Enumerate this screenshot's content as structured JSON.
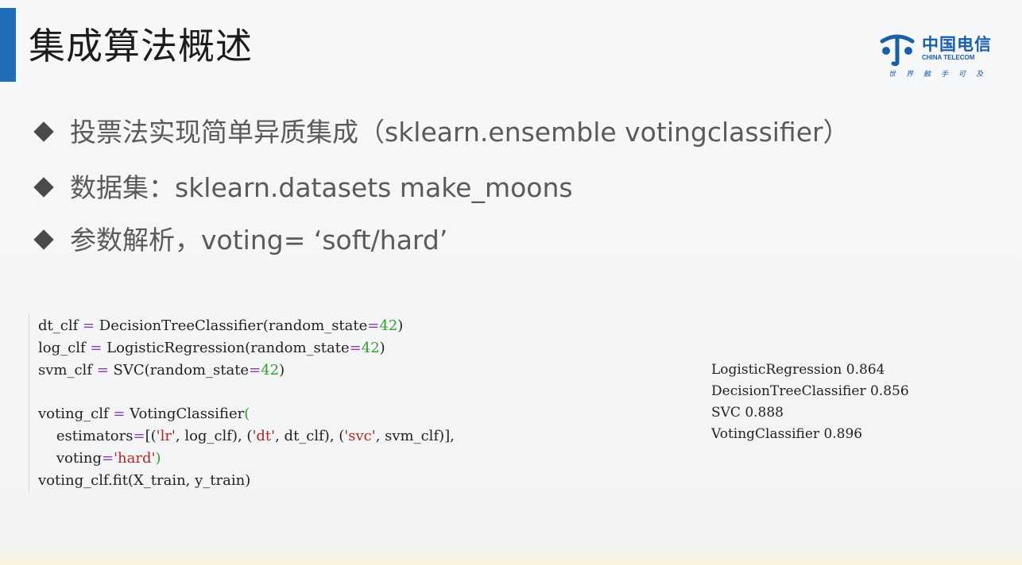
{
  "slide": {
    "title": "集成算法概述"
  },
  "logo": {
    "name_cn": "中国电信",
    "name_en": "CHINA TELECOM",
    "slogan": "世界触手可及",
    "color": "#1a5ea8"
  },
  "bullets": [
    "投票法实现简单异质集成（sklearn.ensemble votingclassifier）",
    "数据集：sklearn.datasets make_moons",
    "参数解析，voting= ‘soft/hard’"
  ],
  "code": {
    "lines": [
      [
        {
          "t": "dt_clf "
        },
        {
          "t": "=",
          "c": "eq"
        },
        {
          "t": " DecisionTreeClassifier(random_state"
        },
        {
          "t": "=",
          "c": "eq"
        },
        {
          "t": "42",
          "c": "num"
        },
        {
          "t": ")"
        }
      ],
      [
        {
          "t": "log_clf "
        },
        {
          "t": "=",
          "c": "eq"
        },
        {
          "t": " LogisticRegression(random_state"
        },
        {
          "t": "=",
          "c": "eq"
        },
        {
          "t": "42",
          "c": "num"
        },
        {
          "t": ")"
        }
      ],
      [
        {
          "t": "svm_clf "
        },
        {
          "t": "=",
          "c": "eq"
        },
        {
          "t": " SVC(random_state"
        },
        {
          "t": "=",
          "c": "eq"
        },
        {
          "t": "42",
          "c": "num"
        },
        {
          "t": ")"
        }
      ],
      [
        {
          "t": ""
        }
      ],
      [
        {
          "t": "voting_clf "
        },
        {
          "t": "=",
          "c": "eq"
        },
        {
          "t": " VotingClassifier"
        },
        {
          "t": "(",
          "c": "paren"
        }
      ],
      [
        {
          "t": "    estimators"
        },
        {
          "t": "=",
          "c": "eq"
        },
        {
          "t": "[("
        },
        {
          "t": "'lr'",
          "c": "str"
        },
        {
          "t": ", log_clf), ("
        },
        {
          "t": "'dt'",
          "c": "str"
        },
        {
          "t": ", dt_clf), ("
        },
        {
          "t": "'svc'",
          "c": "str"
        },
        {
          "t": ", svm_clf)],"
        }
      ],
      [
        {
          "t": "    voting"
        },
        {
          "t": "=",
          "c": "eq"
        },
        {
          "t": "'hard'",
          "c": "str"
        },
        {
          "t": ")",
          "c": "paren"
        }
      ],
      [
        {
          "t": "voting_clf.fit(X_train, y_train)"
        }
      ]
    ]
  },
  "output": [
    "LogisticRegression 0.864",
    "DecisionTreeClassifier 0.856",
    "SVC 0.888",
    "VotingClassifier 0.896"
  ]
}
